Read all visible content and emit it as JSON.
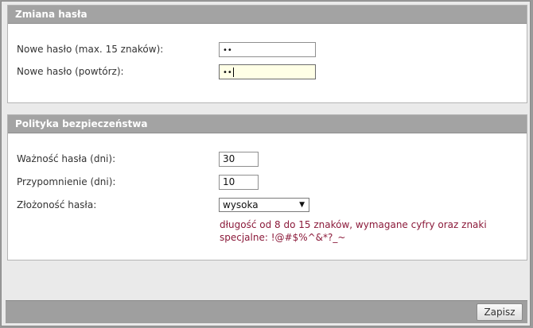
{
  "password_change": {
    "title": "Zmiana hasła",
    "new_password_label": "Nowe hasło (max. 15 znaków):",
    "new_password_value": "••",
    "repeat_password_label": "Nowe hasło (powtórz):",
    "repeat_password_value": "••"
  },
  "security_policy": {
    "title": "Polityka bezpieczeństwa",
    "validity_label": "Ważność hasła (dni):",
    "validity_value": "30",
    "reminder_label": "Przypomnienie (dni):",
    "reminder_value": "10",
    "complexity_label": "Złożoność hasła:",
    "complexity_value": "wysoka",
    "complexity_note_line1": "długość od 8 do 15 znaków, wymagane cyfry oraz znaki",
    "complexity_note_line2": "specjalne: !@#$%^&*?_~"
  },
  "footer": {
    "save_label": "Zapisz"
  },
  "colors": {
    "header_bg": "#a3a3a3",
    "note_text": "#8b1a3a",
    "focused_input_bg": "#ffffe6"
  },
  "icons": {
    "select_arrow": "triangle-down-icon"
  }
}
